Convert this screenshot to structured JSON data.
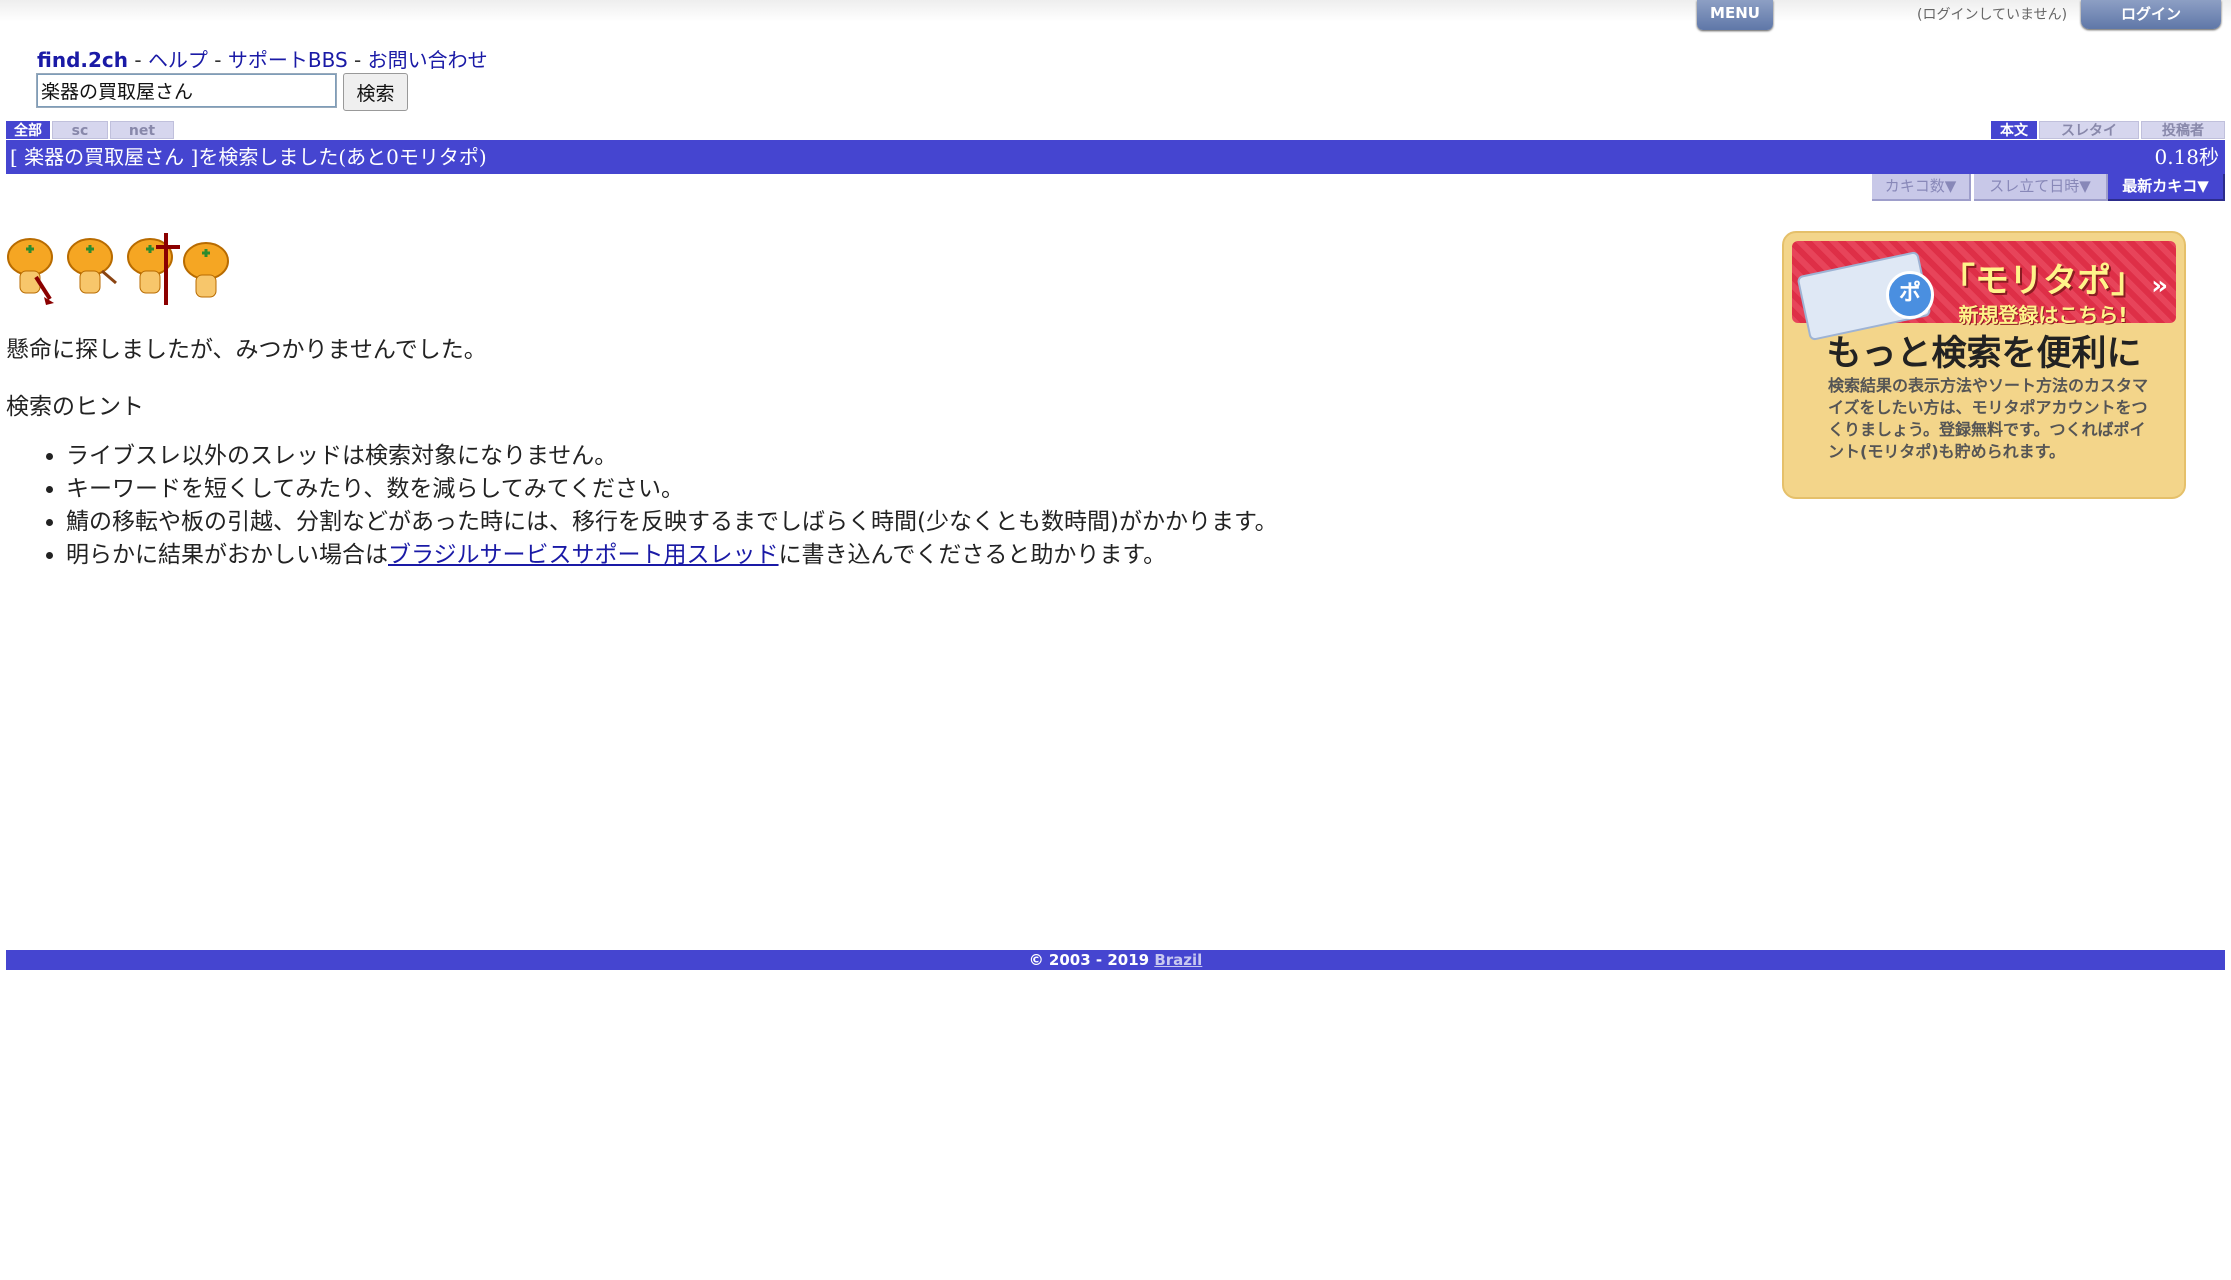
{
  "header": {
    "menu_label": "MENU",
    "login_status": "(ログインしていません)",
    "login_label": "ログイン"
  },
  "nav": {
    "brand": "find.2ch",
    "sep": "-",
    "help": "ヘルプ",
    "support_bbs": "サポートBBS",
    "contact": "お問い合わせ"
  },
  "search": {
    "query": "楽器の買取屋さん",
    "button_label": "検索"
  },
  "scope_tabs": [
    {
      "label": "全部",
      "active": true
    },
    {
      "label": "sc",
      "active": false
    },
    {
      "label": "net",
      "active": false
    }
  ],
  "field_tabs": [
    {
      "label": "本文",
      "active": true
    },
    {
      "label": "スレタイ",
      "active": false
    },
    {
      "label": "投稿者",
      "active": false
    }
  ],
  "result": {
    "message": "[ 楽器の買取屋さん ]を検索しました(あと0モリタポ)",
    "time": "0.18秒"
  },
  "sort_buttons": [
    {
      "label": "カキコ数▼",
      "active": false
    },
    {
      "label": "スレ立て日時▼",
      "active": false
    },
    {
      "label": "最新カキコ▼",
      "active": true
    }
  ],
  "main": {
    "not_found": "懸命に探しましたが、みつかりませんでした。",
    "hint_title": "検索のヒント",
    "hints": [
      "ライブスレ以外のスレッドは検索対象になりません。",
      "キーワードを短くしてみたり、数を減らしてみてください。",
      "鯖の移転や板の引越、分割などがあった時には、移行を反映するまでしばらく時間(少なくとも数時間)がかかります。"
    ],
    "hint4_prefix": "明らかに結果がおかしい場合は",
    "hint4_link": "ブラジルサービスサポート用スレッド",
    "hint4_suffix": "に書き込んでくださると助かります。"
  },
  "banner": {
    "badge": "ポ",
    "title": "「モリタポ」",
    "subtitle": "新規登録はこちら!",
    "headline": "もっと検索を便利に",
    "description": "検索結果の表示方法やソート方法のカスタマイズをしたい方は、モリタポアカウントをつくりましょう。登録無料です。つくればポイント(モリタポ)も貯められます。"
  },
  "footer": {
    "copyright": "© 2003 - 2019",
    "link": "Brazil"
  },
  "colors": {
    "accent_blue": "#4545d0",
    "link_blue": "#1a1aa6",
    "banner_bg": "#f3d58a",
    "banner_red": "#e7445a"
  }
}
